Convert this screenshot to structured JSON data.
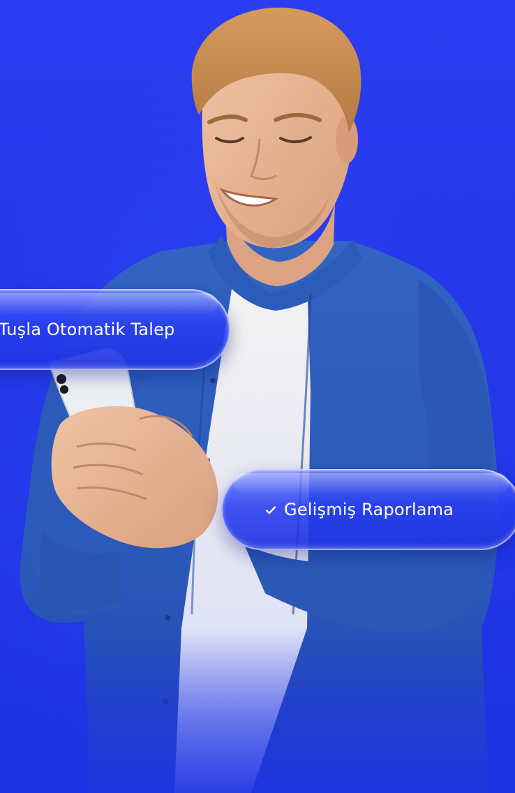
{
  "background": {
    "color_top": "#2a3df0",
    "color_bottom": "#1e33e4"
  },
  "photo": {
    "subject": "man-with-phone",
    "shirt_color": "#2f5fbf",
    "tshirt_color": "#f2f0ee",
    "skin_color": "#e4b596",
    "hair_color": "#c98a4e"
  },
  "pills": [
    {
      "label": "Tuşla Otomatik Talep",
      "icon": ""
    },
    {
      "label": "Gelişmiş Raporlama",
      "icon": "check-icon"
    }
  ]
}
